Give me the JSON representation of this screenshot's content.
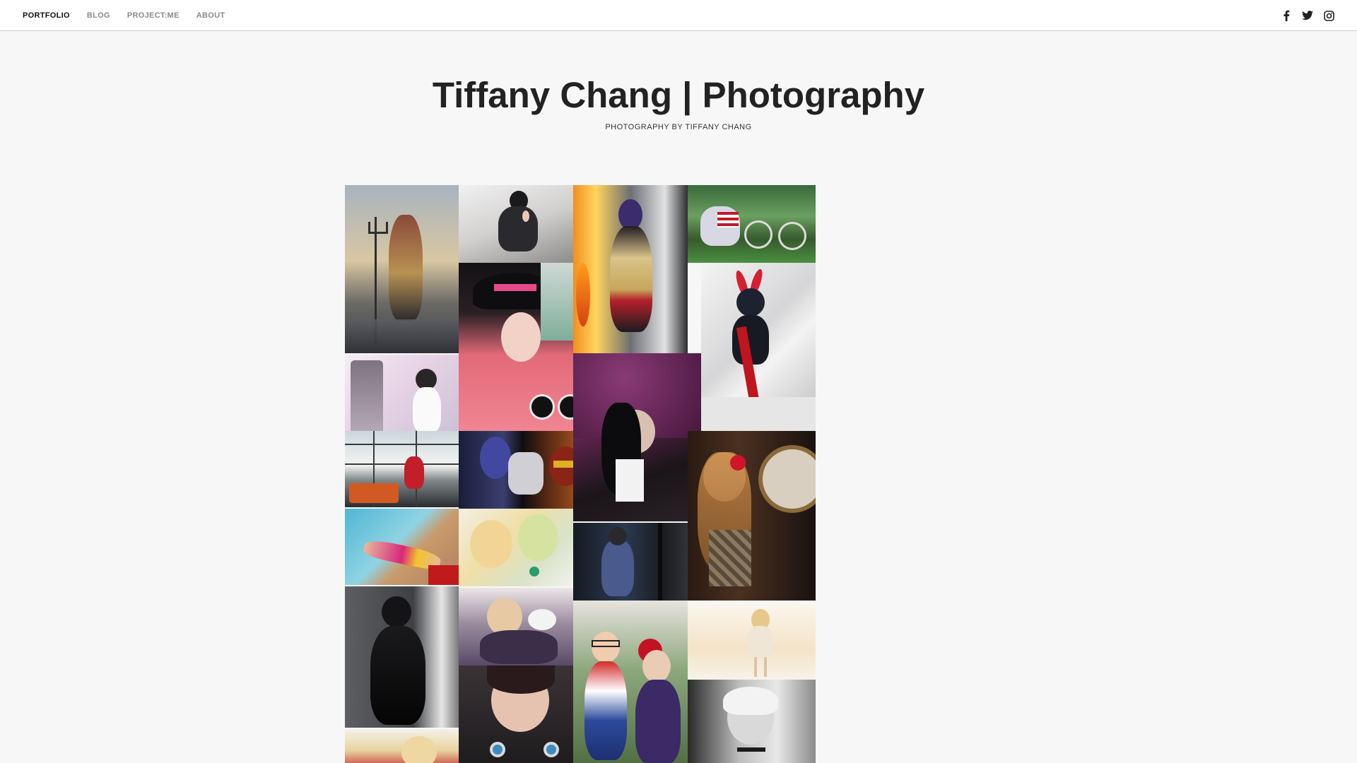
{
  "nav": {
    "items": [
      {
        "label": "PORTFOLIO",
        "active": true
      },
      {
        "label": "BLOG",
        "active": false
      },
      {
        "label": "PROJECT:ME",
        "active": false
      },
      {
        "label": "ABOUT",
        "active": false
      }
    ]
  },
  "social": {
    "icons": [
      "facebook-icon",
      "twitter-icon",
      "instagram-icon"
    ],
    "icon_color": "#222222"
  },
  "header": {
    "title": "Tiffany Chang | Photography",
    "tagline": "PHOTOGRAPHY BY TIFFANY CHANG"
  },
  "gallery": {
    "photo_count": 24
  },
  "colors": {
    "page_background": "#f7f7f7",
    "topbar_background": "#ffffff",
    "nav_active": "#111111",
    "nav_inactive": "#8a8a8a"
  }
}
